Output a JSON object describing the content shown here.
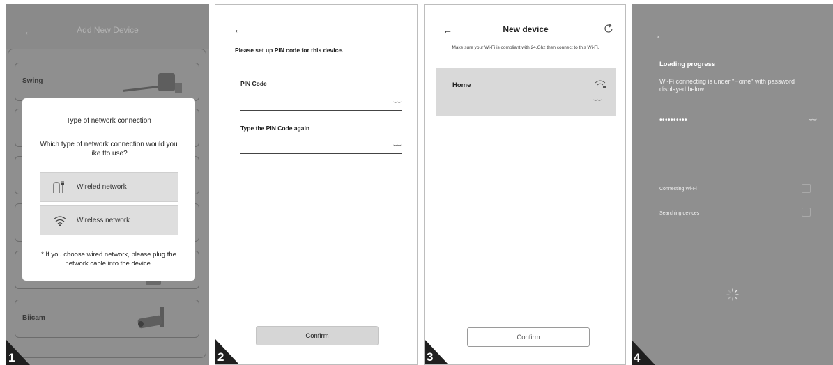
{
  "steps": [
    "1",
    "2",
    "3",
    "4"
  ],
  "panel1": {
    "title": "Add New Device",
    "devices": [
      {
        "label": "Swing"
      },
      {
        "label": ""
      },
      {
        "label": ""
      },
      {
        "label": ""
      },
      {
        "label": ""
      },
      {
        "label": "Biicam"
      }
    ],
    "modal": {
      "title": "Type of network connection",
      "question": "Which type of network connection would you like tto use?",
      "options": [
        {
          "label": "Wireled network",
          "icon": "ethernet-plug-icon"
        },
        {
          "label": "Wireless network",
          "icon": "wifi-icon"
        }
      ],
      "note": "* If you choose wired network, please plug the network cable into the device."
    }
  },
  "panel2": {
    "heading": "Please set up PIN code for this device.",
    "pin_label": "PIN Code",
    "pin_again_label": "Type the PIN Code again",
    "confirm": "Confirm"
  },
  "panel3": {
    "title": "New device",
    "note": "Make sure your Wi-Fi is compliant with 24.Ghz then connect to this Wi-Fi.",
    "network": "Home",
    "confirm": "Confirm"
  },
  "panel4": {
    "heading": "Loading progress",
    "text": "Wi-Fi connecting is under \"Home\" with password displayed below",
    "password": "••••••••••",
    "rows": [
      "Connecting Wi-Fi",
      "Searching devices"
    ]
  },
  "colors": {
    "dim_background": "#8f8f8f",
    "card_gray": "#dedede",
    "button_gray": "#d6d6d6",
    "text_dark": "#222222"
  }
}
